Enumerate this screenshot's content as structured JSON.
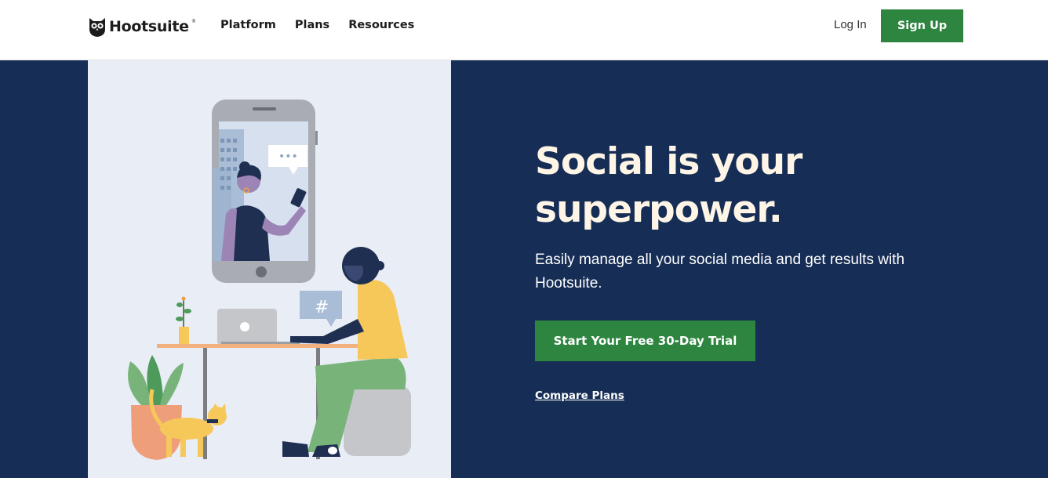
{
  "header": {
    "logo_text": "Hootsuite",
    "logo_mark": "®",
    "nav": [
      {
        "label": "Platform"
      },
      {
        "label": "Plans"
      },
      {
        "label": "Resources"
      }
    ],
    "login_label": "Log In",
    "signup_label": "Sign Up"
  },
  "hero": {
    "headline": "Social is your superpower.",
    "subtext": "Easily manage all your social media and get results with Hootsuite.",
    "cta_label": "Start Your Free 30-Day Trial",
    "compare_label": "Compare Plans",
    "illustration": {
      "chat_bubble_text": "•••",
      "hashtag_text": "#"
    }
  },
  "colors": {
    "brand_green": "#2e8540",
    "hero_navy": "#162d55",
    "illustration_bg": "#e8edf6",
    "headline_cream": "#fff5e6"
  },
  "icons": [
    "owl-logo-icon"
  ]
}
